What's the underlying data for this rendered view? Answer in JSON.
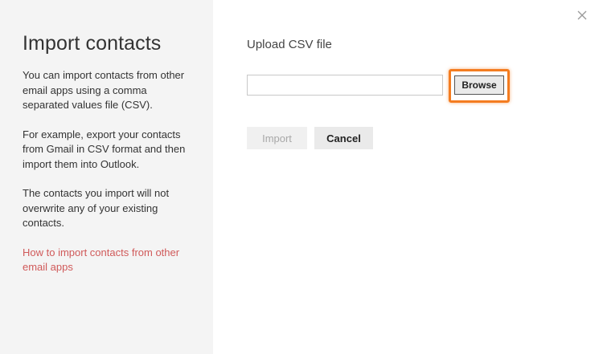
{
  "sidebar": {
    "title": "Import contacts",
    "paragraph1": "You can import contacts from other email apps using a comma separated values file (CSV).",
    "paragraph2": "For example, export your contacts from Gmail in CSV format and then import them into Outlook.",
    "paragraph3": "The contacts you import will not overwrite any of your existing contacts.",
    "help_link": "How to import contacts from other email apps"
  },
  "main": {
    "upload_label": "Upload CSV file",
    "file_input_value": "",
    "browse_label": "Browse",
    "import_label": "Import",
    "cancel_label": "Cancel"
  },
  "icons": {
    "close": "close-icon"
  },
  "colors": {
    "sidebar_background": "#f4f4f4",
    "link": "#d05a5a",
    "highlight": "#f47c20",
    "disabled_text": "#a8a8a8"
  }
}
